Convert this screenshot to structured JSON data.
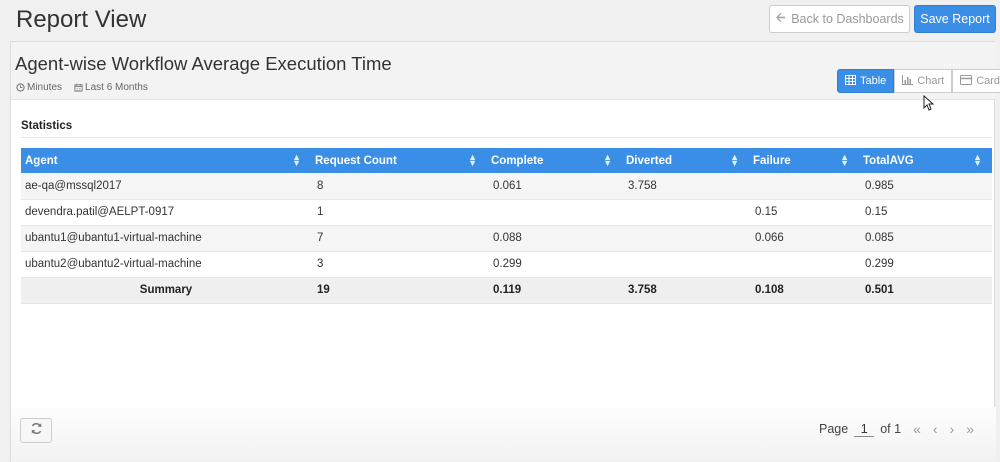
{
  "header": {
    "title": "Report View",
    "back_label": "Back to Dashboards",
    "save_label": "Save Report"
  },
  "report": {
    "title": "Agent-wise Workflow Average Execution Time",
    "unit": "Minutes",
    "range": "Last 6 Months",
    "views": [
      "Table",
      "Chart",
      "Card"
    ],
    "active_view": "Table"
  },
  "stats": {
    "label": "Statistics",
    "columns": [
      "Agent",
      "Request Count",
      "Complete",
      "Diverted",
      "Failure",
      "TotalAVG"
    ],
    "rows": [
      [
        "ae-qa@mssql2017",
        "8",
        "0.061",
        "3.758",
        "",
        "0.985"
      ],
      [
        "devendra.patil@AELPT-0917",
        "1",
        "",
        "",
        "0.15",
        "0.15"
      ],
      [
        "ubantu1@ubantu1-virtual-machine",
        "7",
        "0.088",
        "",
        "0.066",
        "0.085"
      ],
      [
        "ubantu2@ubantu2-virtual-machine",
        "3",
        "0.299",
        "",
        "",
        "0.299"
      ]
    ],
    "summary": [
      "Summary",
      "19",
      "0.119",
      "3.758",
      "0.108",
      "0.501"
    ]
  },
  "pager": {
    "page_label": "Page",
    "page_value": "1",
    "of_label": "of 1"
  },
  "colors": {
    "accent": "#3a8ee6"
  }
}
